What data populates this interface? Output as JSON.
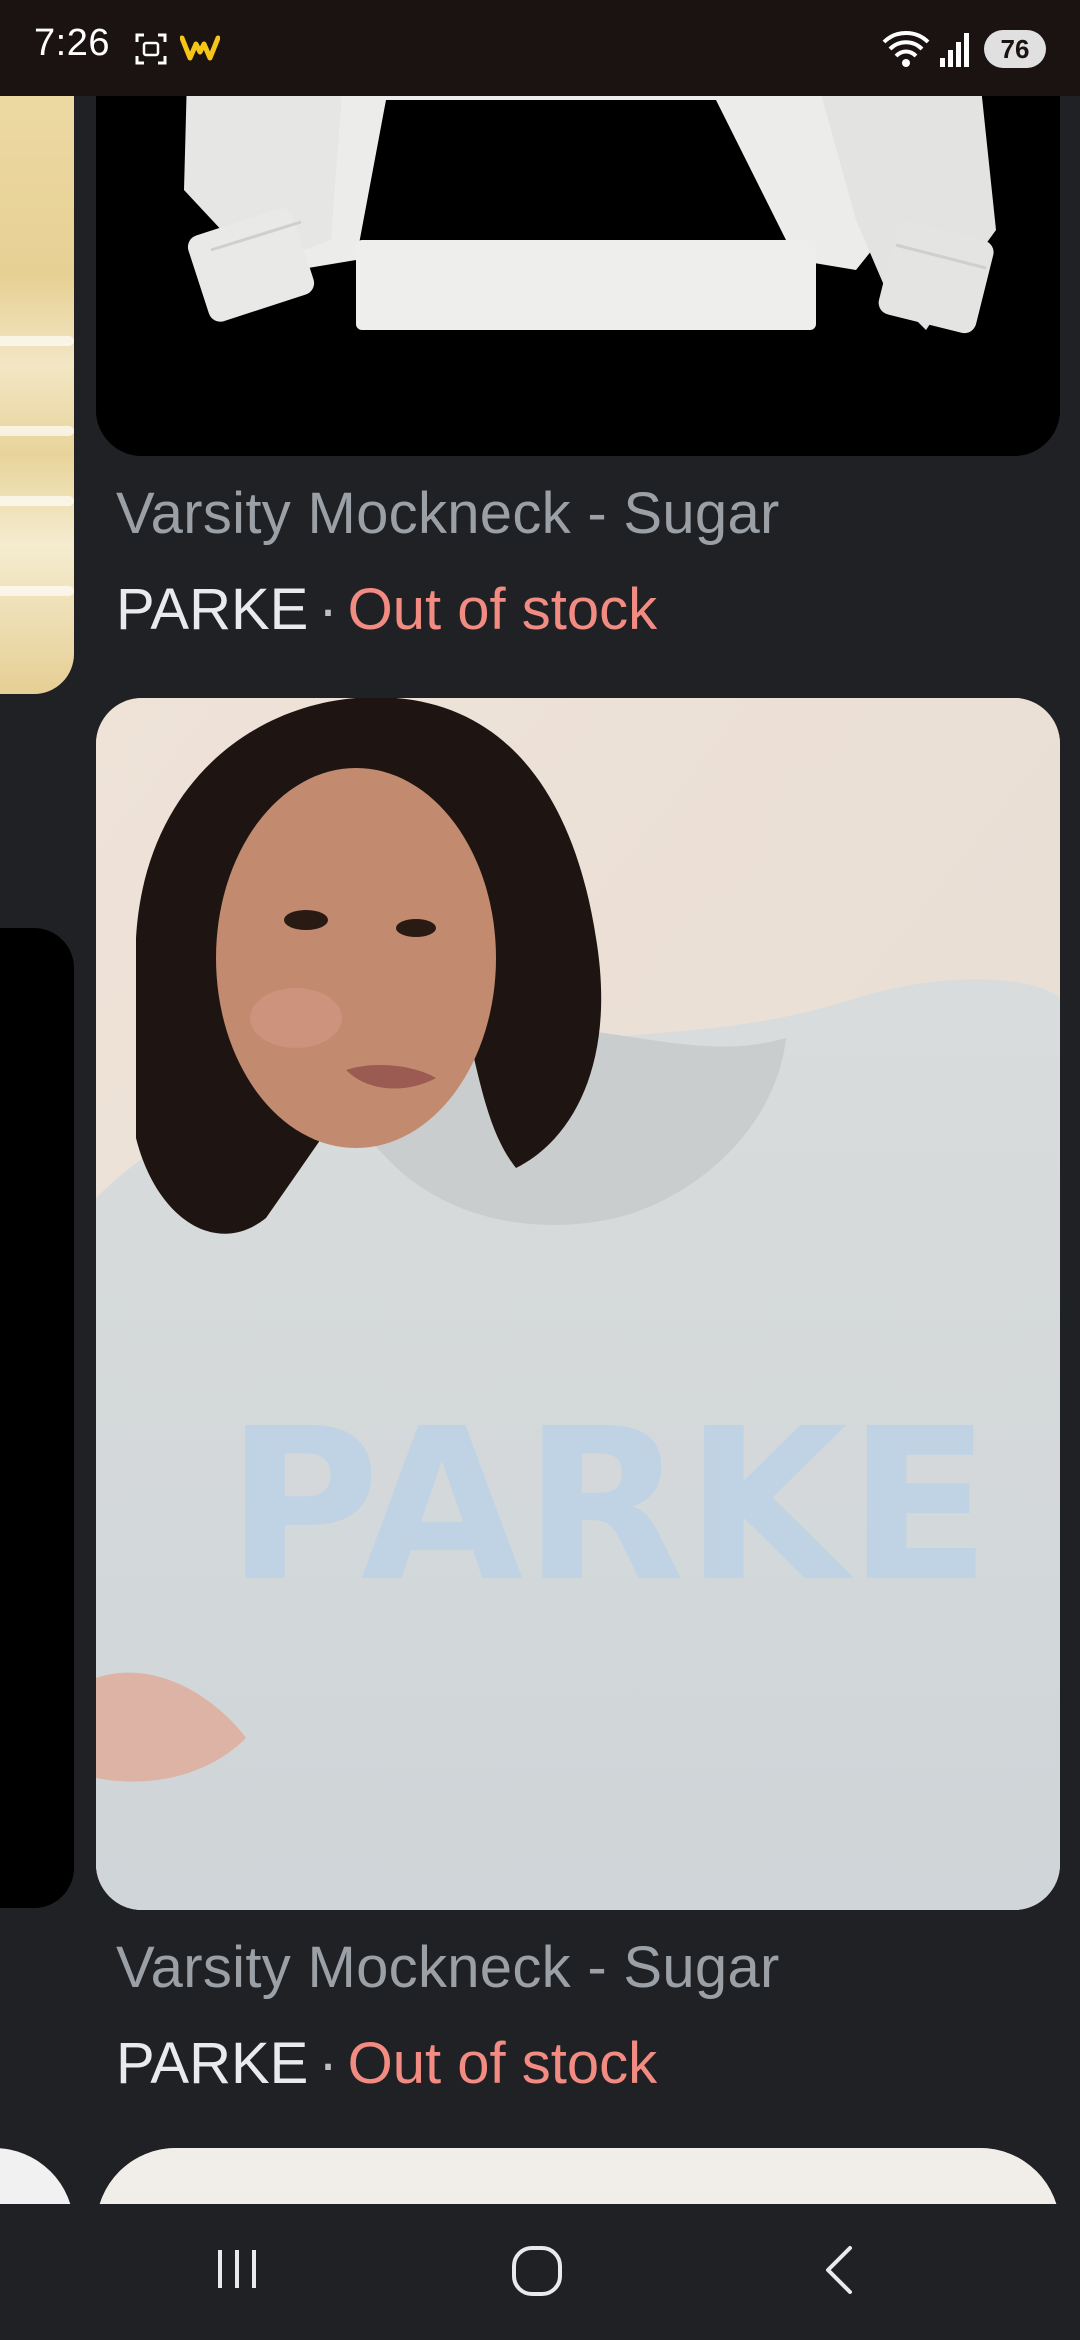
{
  "status_bar": {
    "time": "7:26",
    "battery": "76",
    "icons": [
      "screenshot-icon",
      "app-notification-icon",
      "wifi-icon",
      "signal-icon"
    ]
  },
  "results": [
    {
      "title": "Varsity Mockneck - Sugar",
      "brand": "PARKE",
      "separator": "·",
      "stock": "Out of stock"
    },
    {
      "title": "Varsity Mockneck - Sugar",
      "brand": "PARKE",
      "separator": "·",
      "stock": "Out of stock",
      "sweater_print": "PARKE"
    }
  ],
  "colors": {
    "background": "#202124",
    "title_gray": "#9aa0a6",
    "brand_white": "#e8eaed",
    "out_of_stock": "#f28b82",
    "status_bar": "#1a1311"
  },
  "nav_bar": {
    "icons": [
      "recents-icon",
      "home-icon",
      "back-icon"
    ]
  }
}
